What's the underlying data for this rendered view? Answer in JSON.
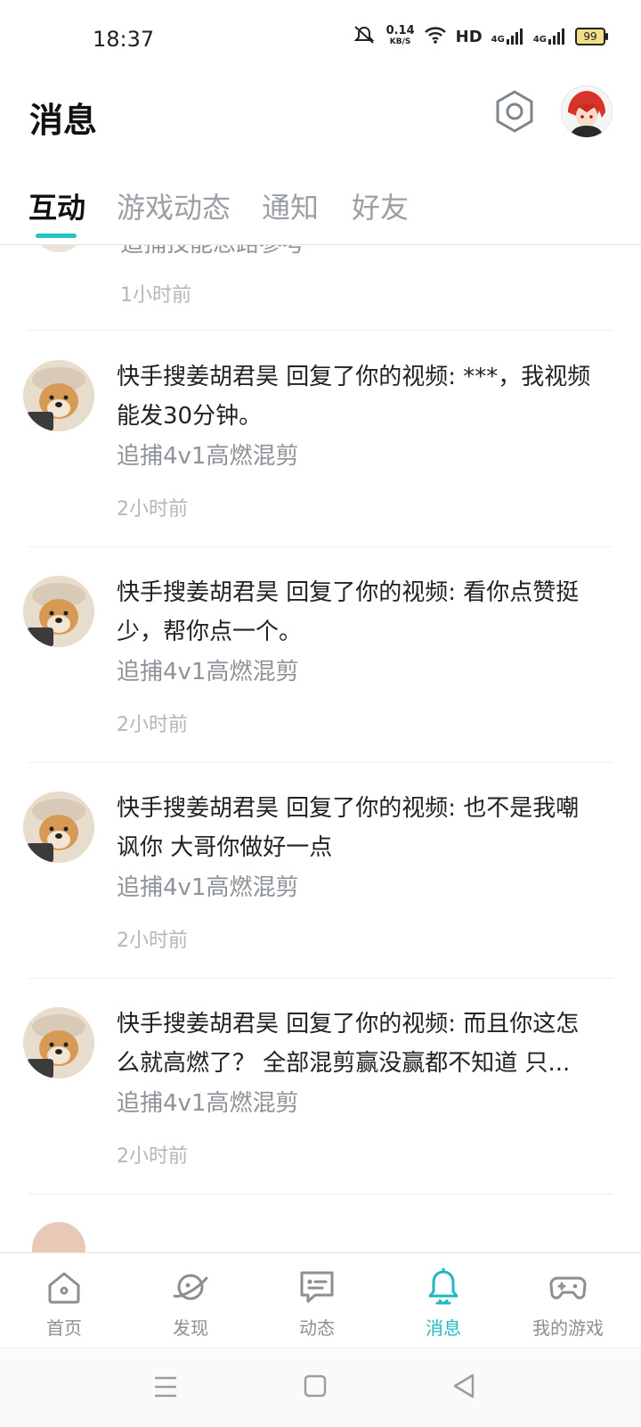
{
  "status_bar": {
    "time": "18:37",
    "net_speed_value": "0.14",
    "net_speed_unit": "KB/S",
    "hd": "HD",
    "signal_1": "4G",
    "signal_2": "4G",
    "battery": "99"
  },
  "header": {
    "title": "消息"
  },
  "tabs": [
    {
      "label": "互动",
      "active": true
    },
    {
      "label": "游戏动态",
      "active": false
    },
    {
      "label": "通知",
      "active": false
    },
    {
      "label": "好友",
      "active": false
    }
  ],
  "feed": {
    "partial_top": {
      "topic": "追捕技能思路参考",
      "time": "1小时前"
    },
    "items": [
      {
        "message": "快手搜姜胡君昊 回复了你的视频: ***，我视频能发30分钟。",
        "topic": "追捕4v1高燃混剪",
        "time": "2小时前"
      },
      {
        "message": "快手搜姜胡君昊 回复了你的视频: 看你点赞挺少，帮你点一个。",
        "topic": "追捕4v1高燃混剪",
        "time": "2小时前"
      },
      {
        "message": "快手搜姜胡君昊 回复了你的视频: 也不是我嘲讽你 大哥你做好一点",
        "topic": "追捕4v1高燃混剪",
        "time": "2小时前"
      },
      {
        "message": "快手搜姜胡君昊 回复了你的视频: 而且你这怎么就高燃了？ 全部混剪赢没赢都不知道 只...",
        "topic": "追捕4v1高燃混剪",
        "time": "2小时前"
      }
    ]
  },
  "bottom_nav": [
    {
      "label": "首页",
      "icon": "home-icon",
      "active": false
    },
    {
      "label": "发现",
      "icon": "planet-icon",
      "active": false
    },
    {
      "label": "动态",
      "icon": "chat-icon",
      "active": false
    },
    {
      "label": "消息",
      "icon": "bell-icon",
      "active": true
    },
    {
      "label": "我的游戏",
      "icon": "gamepad-icon",
      "active": false
    }
  ],
  "colors": {
    "accent": "#27c2c6",
    "text_primary": "#222222",
    "text_secondary": "#8e9399",
    "text_muted": "#b3b6ba"
  }
}
